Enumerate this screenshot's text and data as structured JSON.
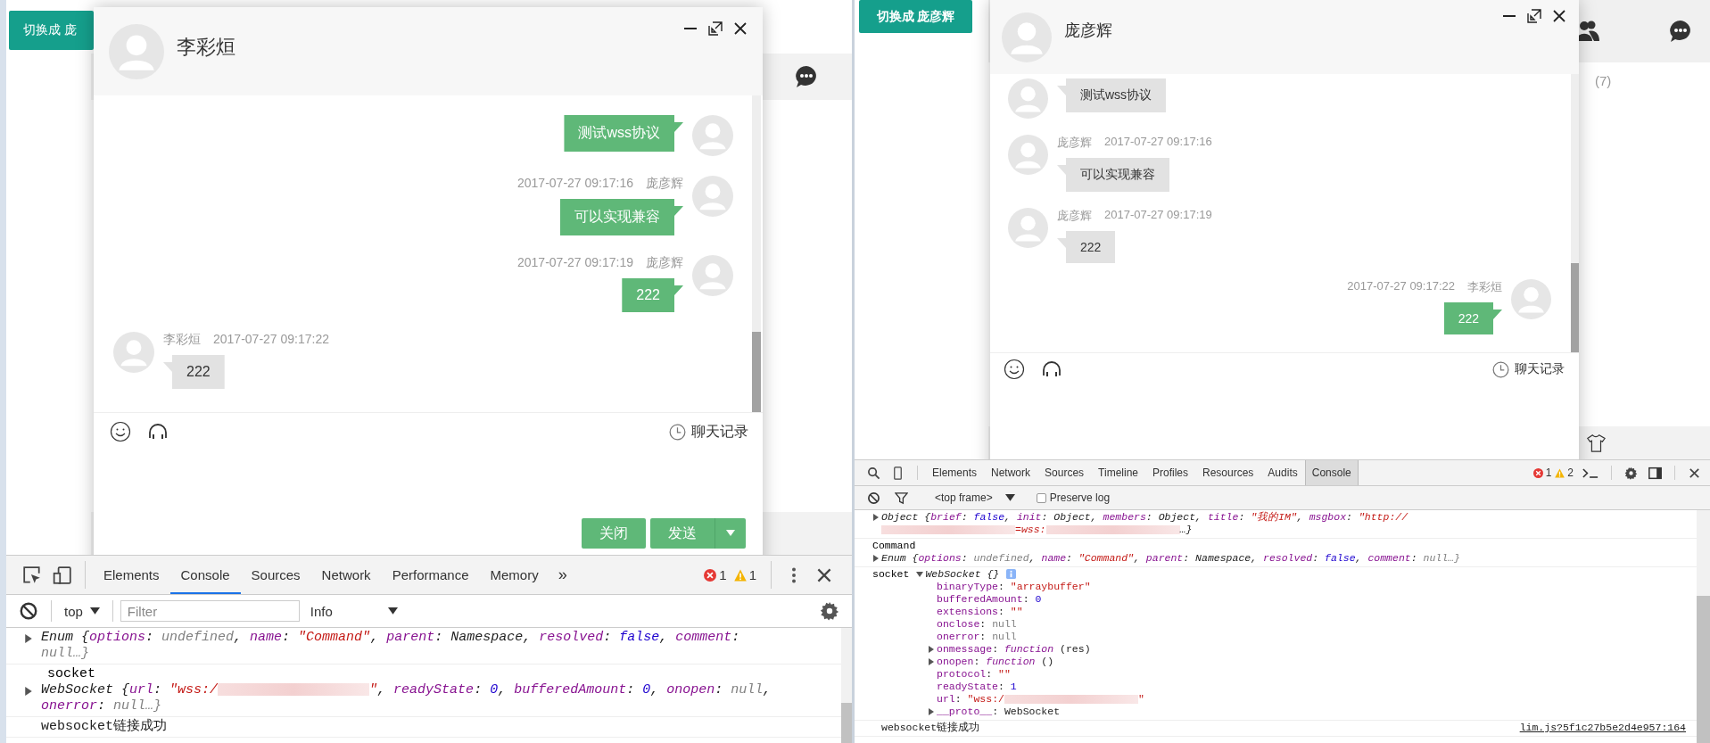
{
  "left": {
    "switch_button": "切换成 庞",
    "chat": {
      "title": "李彩烜",
      "messages": [
        {
          "kind": "outgoing",
          "text": "测试wss协议"
        },
        {
          "kind": "outgoing",
          "name": "庞彦辉",
          "time": "2017-07-27 09:17:16",
          "text": "可以实现兼容"
        },
        {
          "kind": "outgoing",
          "name": "庞彦辉",
          "time": "2017-07-27 09:17:19",
          "text": "222"
        },
        {
          "kind": "incoming",
          "name": "李彩烜",
          "time": "2017-07-27 09:17:22",
          "text": "222"
        }
      ],
      "history_label": "聊天记录",
      "buttons": [
        {
          "label": "关闭",
          "kind": "plain"
        },
        {
          "label": "发送",
          "kind": "split"
        }
      ]
    },
    "devtools": {
      "tabs": [
        {
          "label": "Elements",
          "selected": false
        },
        {
          "label": "Console",
          "selected": true
        },
        {
          "label": "Sources",
          "selected": false
        },
        {
          "label": "Network",
          "selected": false
        },
        {
          "label": "Performance",
          "selected": false
        },
        {
          "label": "Memory",
          "selected": false
        }
      ],
      "more_tabs": "»",
      "errors": "1",
      "warnings": "1",
      "context": "top",
      "filter_placeholder": "Filter",
      "level_filter": "Info",
      "console": [
        {
          "kind": "collapsed",
          "segments": [
            {
              "kind": "plain",
              "text": "Enum {"
            },
            {
              "kind": "key",
              "text": "options"
            },
            {
              "kind": "plain",
              "text": ": "
            },
            {
              "kind": "null",
              "text": "undefined"
            },
            {
              "kind": "plain",
              "text": ", "
            },
            {
              "kind": "key",
              "text": "name"
            },
            {
              "kind": "plain",
              "text": ": "
            },
            {
              "kind": "str",
              "text": "\"Command\""
            },
            {
              "kind": "plain",
              "text": ", "
            },
            {
              "kind": "key",
              "text": "parent"
            },
            {
              "kind": "plain",
              "text": ": "
            },
            {
              "kind": "obj",
              "text": "Namespace"
            },
            {
              "kind": "plain",
              "text": ", "
            },
            {
              "kind": "key",
              "text": "resolved"
            },
            {
              "kind": "plain",
              "text": ": "
            },
            {
              "kind": "num",
              "text": "false"
            },
            {
              "kind": "plain",
              "text": ", "
            },
            {
              "kind": "key",
              "text": "comment"
            },
            {
              "kind": "plain",
              "text": ": "
            },
            {
              "kind": "null",
              "text": "null…}"
            }
          ]
        },
        {
          "label": "socket",
          "label_inline": false,
          "kind": "collapsed",
          "segments": [
            {
              "kind": "plain",
              "text": "WebSocket {"
            },
            {
              "kind": "key",
              "text": "url"
            },
            {
              "kind": "plain",
              "text": ": "
            },
            {
              "kind": "str",
              "text": "\"wss:/"
            },
            {
              "kind": "redacted"
            },
            {
              "kind": "str",
              "text": "\""
            },
            {
              "kind": "plain",
              "text": ", "
            },
            {
              "kind": "key",
              "text": "readyState"
            },
            {
              "kind": "plain",
              "text": ": "
            },
            {
              "kind": "num",
              "text": "0"
            },
            {
              "kind": "plain",
              "text": ", "
            },
            {
              "kind": "key",
              "text": "bufferedAmount"
            },
            {
              "kind": "plain",
              "text": ": "
            },
            {
              "kind": "num",
              "text": "0"
            },
            {
              "kind": "plain",
              "text": ", "
            },
            {
              "kind": "key",
              "text": "onopen"
            },
            {
              "kind": "plain",
              "text": ": "
            },
            {
              "kind": "null",
              "text": "null"
            },
            {
              "kind": "plain",
              "text": ", "
            },
            {
              "kind": "key",
              "text": "onerror"
            },
            {
              "kind": "plain",
              "text": ": "
            },
            {
              "kind": "null",
              "text": "null…}"
            }
          ]
        },
        {
          "kind": "text",
          "segments": [
            {
              "kind": "plain",
              "text": "websocket链接成功"
            }
          ]
        }
      ]
    }
  },
  "right": {
    "switch_button": "切换成 庞彦辉",
    "count": "(7)",
    "chat": {
      "title": "庞彦辉",
      "messages": [
        {
          "kind": "incoming",
          "text": "测试wss协议"
        },
        {
          "kind": "incoming",
          "name": "庞彦辉",
          "time": "2017-07-27 09:17:16",
          "text": "可以实现兼容"
        },
        {
          "kind": "incoming",
          "name": "庞彦辉",
          "time": "2017-07-27 09:17:19",
          "text": "222"
        },
        {
          "kind": "outgoing",
          "name": "李彩烜",
          "time": "2017-07-27 09:17:22",
          "text": "222"
        }
      ],
      "history_label": "聊天记录"
    },
    "devtools": {
      "tabs": [
        {
          "label": "Elements",
          "selected": false
        },
        {
          "label": "Network",
          "selected": false
        },
        {
          "label": "Sources",
          "selected": false
        },
        {
          "label": "Timeline",
          "selected": false
        },
        {
          "label": "Profiles",
          "selected": false
        },
        {
          "label": "Resources",
          "selected": false
        },
        {
          "label": "Audits",
          "selected": false
        },
        {
          "label": "Console",
          "selected": true
        }
      ],
      "errors": "1",
      "warnings": "2",
      "context": "<top frame>",
      "preserve_log": {
        "label": "Preserve log",
        "checked": false
      },
      "console": [
        {
          "kind": "collapsed",
          "segments": [
            {
              "kind": "plain",
              "text": "Object {"
            },
            {
              "kind": "key",
              "text": "brief"
            },
            {
              "kind": "plain",
              "text": ": "
            },
            {
              "kind": "num",
              "text": "false"
            },
            {
              "kind": "plain",
              "text": ", "
            },
            {
              "kind": "key",
              "text": "init"
            },
            {
              "kind": "plain",
              "text": ": "
            },
            {
              "kind": "obj",
              "text": "Object"
            },
            {
              "kind": "plain",
              "text": ", "
            },
            {
              "kind": "key",
              "text": "members"
            },
            {
              "kind": "plain",
              "text": ": "
            },
            {
              "kind": "obj",
              "text": "Object"
            },
            {
              "kind": "plain",
              "text": ", "
            },
            {
              "kind": "key",
              "text": "title"
            },
            {
              "kind": "plain",
              "text": ": "
            },
            {
              "kind": "str",
              "text": "\"我的IM\""
            },
            {
              "kind": "plain",
              "text": ", "
            },
            {
              "kind": "key",
              "text": "msgbox"
            },
            {
              "kind": "plain",
              "text": ": "
            },
            {
              "kind": "str",
              "text": "\"http://"
            },
            {
              "kind": "redacted"
            },
            {
              "kind": "str",
              "text": "=wss:"
            },
            {
              "kind": "redacted"
            },
            {
              "kind": "plain",
              "text": "…}"
            }
          ]
        },
        {
          "label": "Command",
          "label_inline": false,
          "kind": "collapsed",
          "segments": [
            {
              "kind": "plain",
              "text": "Enum {"
            },
            {
              "kind": "key",
              "text": "options"
            },
            {
              "kind": "plain",
              "text": ": "
            },
            {
              "kind": "null",
              "text": "undefined"
            },
            {
              "kind": "plain",
              "text": ", "
            },
            {
              "kind": "key",
              "text": "name"
            },
            {
              "kind": "plain",
              "text": ": "
            },
            {
              "kind": "str",
              "text": "\"Command\""
            },
            {
              "kind": "plain",
              "text": ", "
            },
            {
              "kind": "key",
              "text": "parent"
            },
            {
              "kind": "plain",
              "text": ": "
            },
            {
              "kind": "obj",
              "text": "Namespace"
            },
            {
              "kind": "plain",
              "text": ", "
            },
            {
              "kind": "key",
              "text": "resolved"
            },
            {
              "kind": "plain",
              "text": ": "
            },
            {
              "kind": "num",
              "text": "false"
            },
            {
              "kind": "plain",
              "text": ", "
            },
            {
              "kind": "key",
              "text": "comment"
            },
            {
              "kind": "plain",
              "text": ": "
            },
            {
              "kind": "null",
              "text": "null…}"
            }
          ]
        },
        {
          "label": "socket",
          "label_inline": true,
          "kind": "expanded",
          "info_badge": true,
          "segments": [
            {
              "kind": "plain",
              "text": "WebSocket {}"
            }
          ],
          "properties": [
            {
              "kind": "value",
              "segments": [
                {
                  "kind": "key",
                  "text": "binaryType"
                },
                {
                  "kind": "plain",
                  "text": ": "
                },
                {
                  "kind": "str",
                  "text": "\"arraybuffer\""
                }
              ]
            },
            {
              "kind": "value",
              "segments": [
                {
                  "kind": "key",
                  "text": "bufferedAmount"
                },
                {
                  "kind": "plain",
                  "text": ": "
                },
                {
                  "kind": "num",
                  "text": "0"
                }
              ]
            },
            {
              "kind": "value",
              "segments": [
                {
                  "kind": "key",
                  "text": "extensions"
                },
                {
                  "kind": "plain",
                  "text": ": "
                },
                {
                  "kind": "str",
                  "text": "\"\""
                }
              ]
            },
            {
              "kind": "value",
              "segments": [
                {
                  "kind": "key",
                  "text": "onclose"
                },
                {
                  "kind": "plain",
                  "text": ": "
                },
                {
                  "kind": "null",
                  "text": "null"
                }
              ]
            },
            {
              "kind": "value",
              "segments": [
                {
                  "kind": "key",
                  "text": "onerror"
                },
                {
                  "kind": "plain",
                  "text": ": "
                },
                {
                  "kind": "null",
                  "text": "null"
                }
              ]
            },
            {
              "kind": "collapsed",
              "segments": [
                {
                  "kind": "key",
                  "text": "onmessage"
                },
                {
                  "kind": "plain",
                  "text": ": "
                },
                {
                  "kind": "func",
                  "text": "function"
                },
                {
                  "kind": "plain",
                  "text": " (res)"
                }
              ]
            },
            {
              "kind": "collapsed",
              "segments": [
                {
                  "kind": "key",
                  "text": "onopen"
                },
                {
                  "kind": "plain",
                  "text": ": "
                },
                {
                  "kind": "func",
                  "text": "function"
                },
                {
                  "kind": "plain",
                  "text": " ()"
                }
              ]
            },
            {
              "kind": "value",
              "segments": [
                {
                  "kind": "key",
                  "text": "protocol"
                },
                {
                  "kind": "plain",
                  "text": ": "
                },
                {
                  "kind": "str",
                  "text": "\"\""
                }
              ]
            },
            {
              "kind": "value",
              "segments": [
                {
                  "kind": "key",
                  "text": "readyState"
                },
                {
                  "kind": "plain",
                  "text": ": "
                },
                {
                  "kind": "num",
                  "text": "1"
                }
              ]
            },
            {
              "kind": "value",
              "segments": [
                {
                  "kind": "key",
                  "text": "url"
                },
                {
                  "kind": "plain",
                  "text": ": "
                },
                {
                  "kind": "str",
                  "text": "\"wss:/"
                },
                {
                  "kind": "redacted"
                },
                {
                  "kind": "str",
                  "text": "\""
                }
              ]
            },
            {
              "kind": "collapsed",
              "segments": [
                {
                  "kind": "key",
                  "text": "__proto__"
                },
                {
                  "kind": "plain",
                  "text": ": "
                },
                {
                  "kind": "plain",
                  "text": "WebSocket"
                }
              ]
            }
          ]
        },
        {
          "kind": "text",
          "segments": [
            {
              "kind": "plain",
              "text": "websocket链接成功"
            }
          ],
          "source": "lim.js?5f1c27b5e2d4e957:164"
        }
      ]
    }
  }
}
